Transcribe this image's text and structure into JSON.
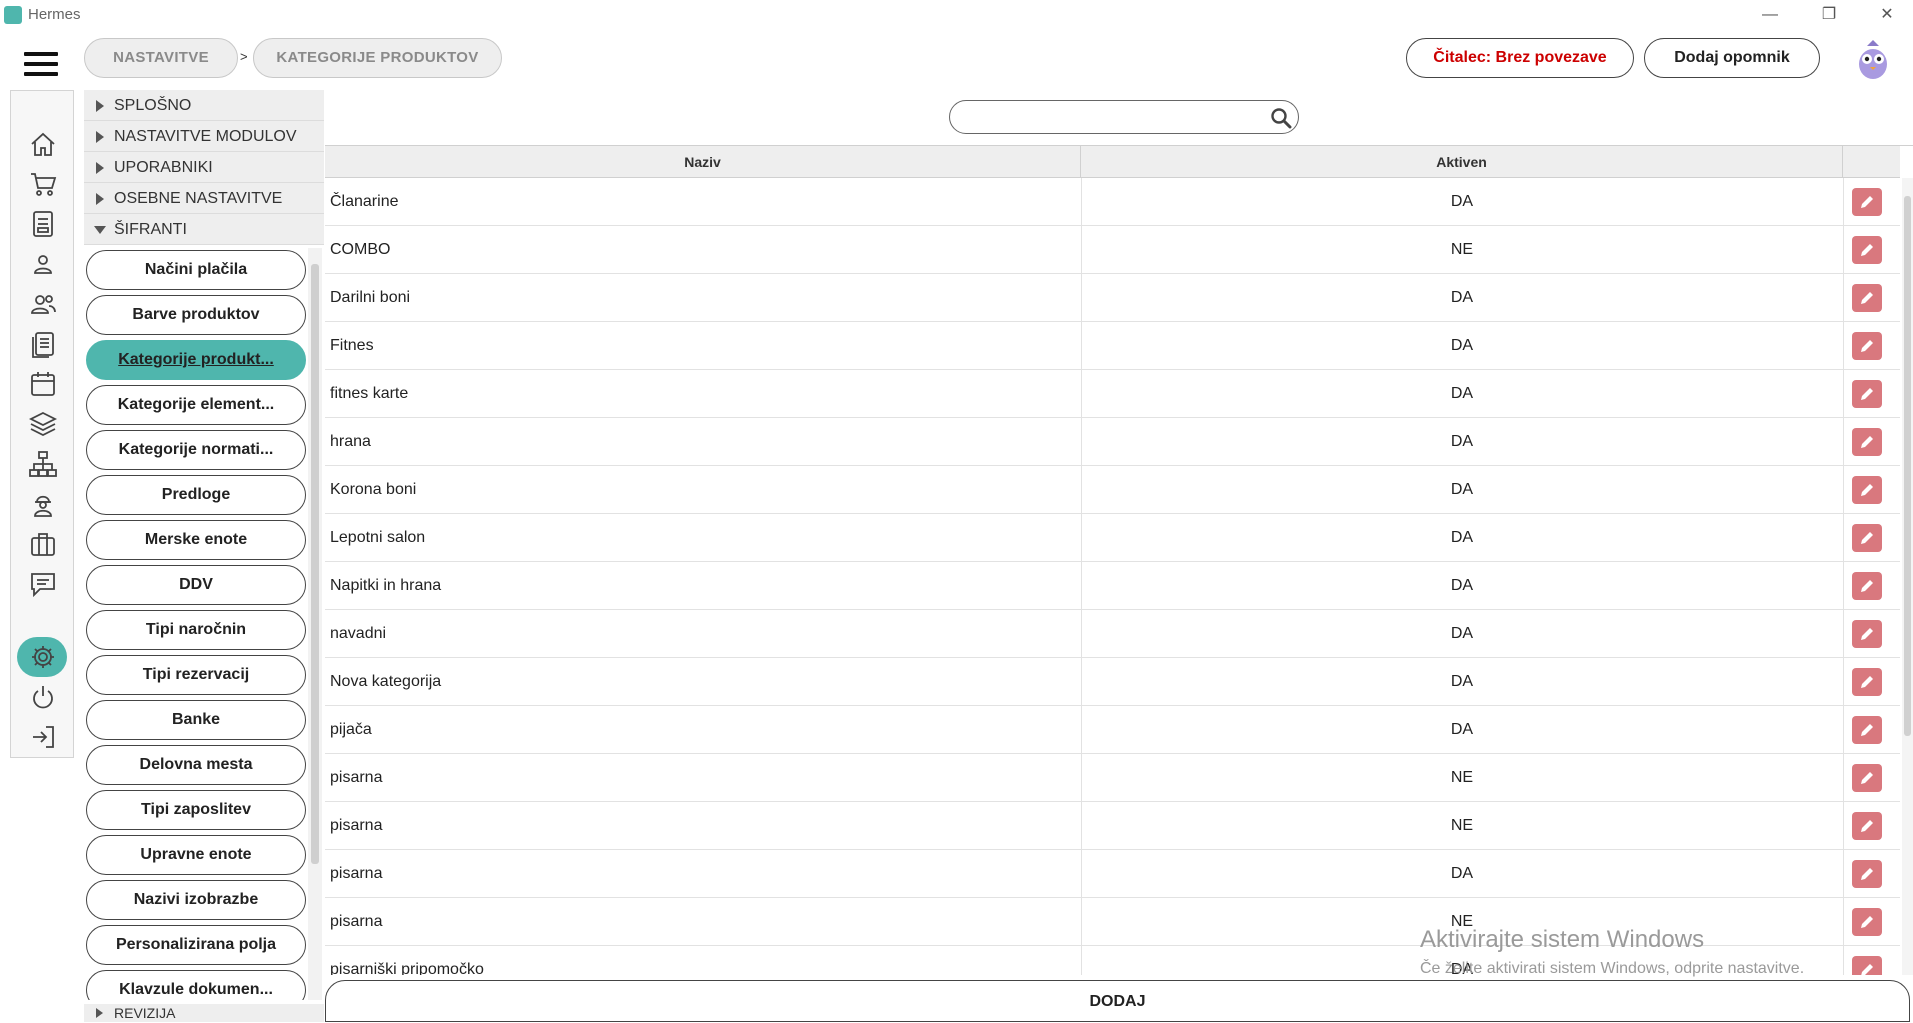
{
  "window": {
    "title": "Hermes",
    "minimize": "—",
    "maximize": "❐",
    "close": "✕"
  },
  "breadcrumb": {
    "items": [
      "NASTAVITVE",
      "KATEGORIJE PRODUKTOV"
    ],
    "separator": ">"
  },
  "header": {
    "reader_status": "Čitalec: Brez povezave",
    "reader_status_color": "#cc0000",
    "add_reminder": "Dodaj opomnik"
  },
  "nav_icons": [
    "home-icon",
    "cart-icon",
    "document-icon",
    "user-icon",
    "users-icon",
    "list-document-icon",
    "calendar-icon",
    "layers-icon",
    "network-icon",
    "worker-icon",
    "briefcase-icon",
    "chat-icon",
    "gear-icon",
    "power-icon",
    "logout-icon"
  ],
  "tree": {
    "sections": [
      "SPLOŠNO",
      "NASTAVITVE MODULOV",
      "UPORABNIKI",
      "OSEBNE NASTAVITVE",
      "ŠIFRANTI"
    ],
    "expanded_section": "ŠIFRANTI",
    "sub_items": [
      "Načini plačila",
      "Barve produktov",
      "Kategorije produkt...",
      "Kategorije element...",
      "Kategorije normati...",
      "Predloge",
      "Merske enote",
      "DDV",
      "Tipi naročnin",
      "Tipi rezervacij",
      "Banke",
      "Delovna mesta",
      "Tipi zaposlitev",
      "Upravne enote",
      "Nazivi izobrazbe",
      "Personalizirana polja",
      "Klavzule dokumen..."
    ],
    "active_sub_item": "Kategorije produkt...",
    "bottom_section": "REVIZIJA"
  },
  "search": {
    "placeholder": "",
    "value": ""
  },
  "table": {
    "columns": [
      "Naziv",
      "Aktiven",
      ""
    ],
    "rows": [
      {
        "naziv": "Članarine",
        "aktiven": "DA"
      },
      {
        "naziv": "COMBO",
        "aktiven": "NE"
      },
      {
        "naziv": "Darilni boni",
        "aktiven": "DA"
      },
      {
        "naziv": "Fitnes",
        "aktiven": "DA"
      },
      {
        "naziv": "fitnes karte",
        "aktiven": "DA"
      },
      {
        "naziv": "hrana",
        "aktiven": "DA"
      },
      {
        "naziv": "Korona boni",
        "aktiven": "DA"
      },
      {
        "naziv": "Lepotni salon",
        "aktiven": "DA"
      },
      {
        "naziv": "Napitki in hrana",
        "aktiven": "DA"
      },
      {
        "naziv": "navadni",
        "aktiven": "DA"
      },
      {
        "naziv": "Nova kategorija",
        "aktiven": "DA"
      },
      {
        "naziv": "pijača",
        "aktiven": "DA"
      },
      {
        "naziv": "pisarna",
        "aktiven": "NE"
      },
      {
        "naziv": "pisarna",
        "aktiven": "NE"
      },
      {
        "naziv": "pisarna",
        "aktiven": "DA"
      },
      {
        "naziv": "pisarna",
        "aktiven": "NE"
      },
      {
        "naziv": "pisarniški pripomočko",
        "aktiven": "DA"
      }
    ]
  },
  "footer": {
    "add_button": "DODAJ"
  },
  "watermark": {
    "title": "Aktivirajte sistem Windows",
    "subtitle": "Če želite aktivirati sistem Windows, odprite nastavitve."
  },
  "colors": {
    "accent": "#4fb6ad",
    "edit_button": "#d9787e"
  }
}
